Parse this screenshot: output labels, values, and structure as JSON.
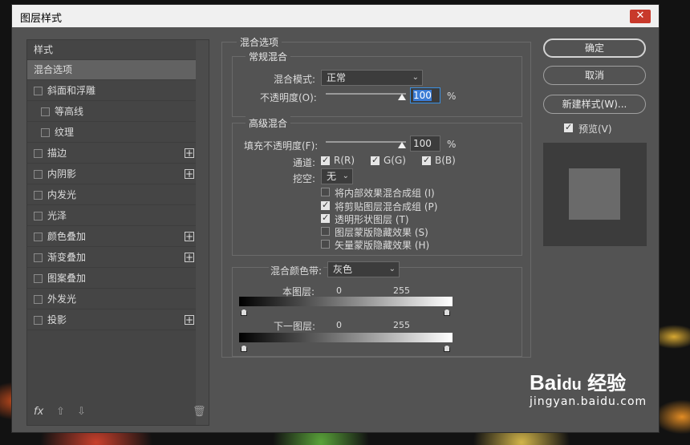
{
  "window": {
    "title": "图层样式",
    "close": "✕"
  },
  "styles_list": {
    "header": "样式",
    "items": [
      {
        "label": "混合选项",
        "selected": true
      },
      {
        "label": "斜面和浮雕"
      },
      {
        "label": "等高线"
      },
      {
        "label": "纹理"
      },
      {
        "label": "描边"
      },
      {
        "label": "内阴影"
      },
      {
        "label": "内发光"
      },
      {
        "label": "光泽"
      },
      {
        "label": "颜色叠加"
      },
      {
        "label": "渐变叠加"
      },
      {
        "label": "图案叠加"
      },
      {
        "label": "外发光"
      },
      {
        "label": "投影"
      }
    ],
    "fx": "fx"
  },
  "blend": {
    "section_title": "混合选项",
    "general": {
      "title": "常规混合",
      "mode_label": "混合模式:",
      "mode_value": "正常",
      "opacity_label": "不透明度(O):",
      "opacity_value": "100",
      "opacity_level": 1.0,
      "percent": "%"
    },
    "advanced": {
      "title": "高级混合",
      "fill_label": "填充不透明度(F):",
      "fill_value": "100",
      "fill_level": 1.0,
      "percent": "%",
      "channels_label": "通道:",
      "channel_r": "R(R)",
      "channel_g": "G(G)",
      "channel_b": "B(B)",
      "knockout_label": "挖空:",
      "knockout_value": "无",
      "options": [
        {
          "label": "将内部效果混合成组 (I)",
          "checked": false
        },
        {
          "label": "将剪贴图层混合成组 (P)",
          "checked": true
        },
        {
          "label": "透明形状图层 (T)",
          "checked": true
        },
        {
          "label": "图层蒙版隐藏效果 (S)",
          "checked": false
        },
        {
          "label": "矢量蒙版隐藏效果 (H)",
          "checked": false
        }
      ]
    },
    "blend_if": {
      "label": "混合颜色带:",
      "value": "灰色",
      "this_layer": "本图层:",
      "underlying": "下一图层:",
      "min": "0",
      "max": "255"
    }
  },
  "buttons": {
    "ok": "确定",
    "cancel": "取消",
    "new_style": "新建样式(W)...",
    "preview": "预览(V)"
  },
  "watermark": {
    "brand": "Bai",
    "paw": "du",
    "cn": "经验",
    "url": "jingyan.baidu.com"
  },
  "colors": {
    "panel": "#535353",
    "list": "#454545",
    "selected": "#626262",
    "accent": "#3a7bd5"
  }
}
